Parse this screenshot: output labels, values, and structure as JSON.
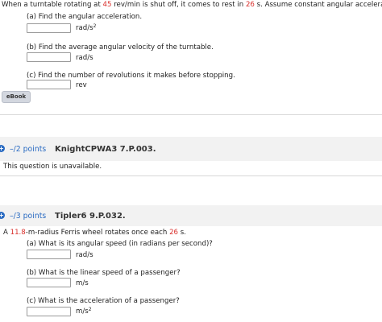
{
  "q1": {
    "prompt_a": "When a turntable rotating at ",
    "rpm": "45",
    "prompt_b": " rev/min is shut off, it comes to rest in ",
    "secs": "26",
    "prompt_c": " s. Assume constant angular acceleration.",
    "parts": [
      {
        "label": "(a) Find the angular acceleration.",
        "unit": "rad/s",
        "unit_sup": "2",
        "value": ""
      },
      {
        "label": "(b) Find the average angular velocity of the turntable.",
        "unit": "rad/s",
        "unit_sup": "",
        "value": ""
      },
      {
        "label": "(c) Find the number of revolutions it makes before stopping.",
        "unit": "rev",
        "unit_sup": "",
        "value": ""
      }
    ],
    "ebook_label": "eBook"
  },
  "q2": {
    "points": "–/2 points",
    "id": "KnightCPWA3 7.P.003.",
    "unavailable": "This question is unavailable."
  },
  "q3": {
    "points": "–/3 points",
    "id": "Tipler6 9.P.032.",
    "prompt_a": "A ",
    "radius": "11.8",
    "prompt_b": "-m-radius Ferris wheel rotates once each ",
    "secs": "26",
    "prompt_c": " s.",
    "parts": [
      {
        "label": "(a) What is its angular speed (in radians per second)?",
        "unit": "rad/s",
        "unit_sup": "",
        "value": ""
      },
      {
        "label": "(b) What is the linear speed of a passenger?",
        "unit": "m/s",
        "unit_sup": "",
        "value": ""
      },
      {
        "label": "(c) What is the acceleration of a passenger?",
        "unit": "m/s",
        "unit_sup": "2",
        "value": ""
      }
    ]
  },
  "colors": {
    "accent": "#2a6bc2",
    "highlight": "#d9302c",
    "band": "#f2f2f2"
  },
  "icons": [
    "plus-icon"
  ]
}
